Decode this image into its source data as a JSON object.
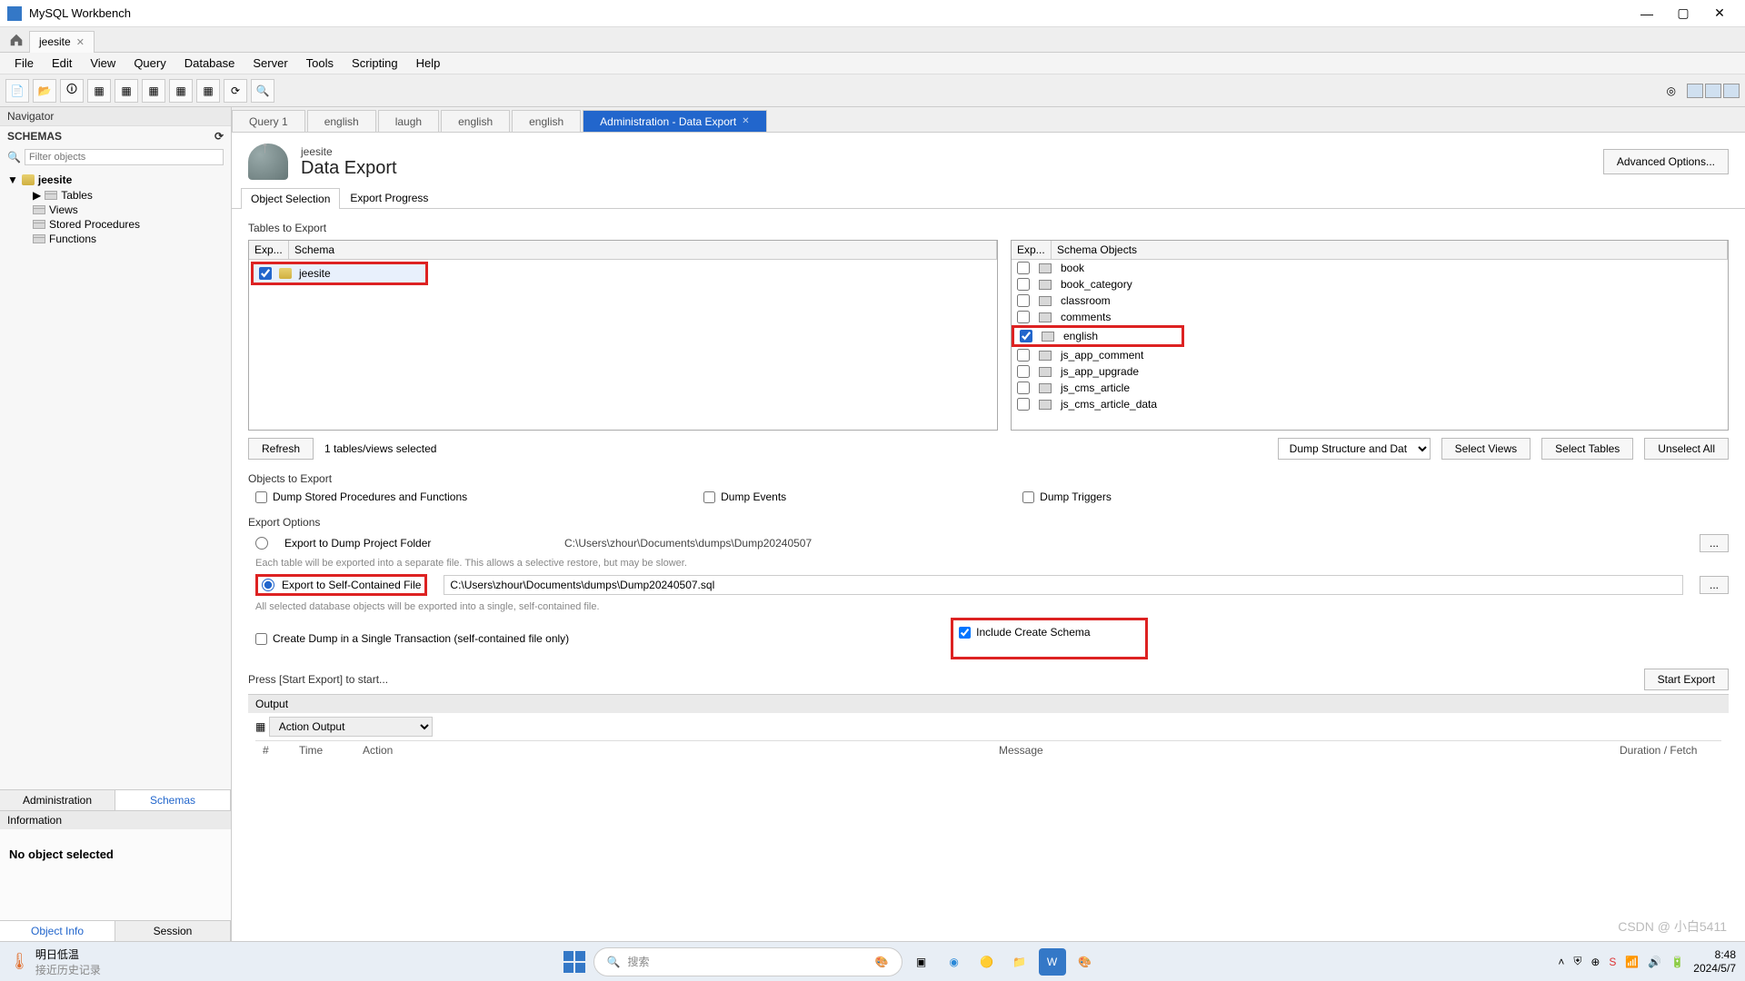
{
  "app": {
    "title": "MySQL Workbench"
  },
  "window_controls": {
    "min": "—",
    "max": "▢",
    "close": "✕"
  },
  "connection_tab": {
    "name": "jeesite"
  },
  "menu": [
    "File",
    "Edit",
    "View",
    "Query",
    "Database",
    "Server",
    "Tools",
    "Scripting",
    "Help"
  ],
  "navigator": {
    "title": "Navigator",
    "schemas_label": "SCHEMAS",
    "filter_placeholder": "Filter objects",
    "db": "jeesite",
    "children": [
      "Tables",
      "Views",
      "Stored Procedures",
      "Functions"
    ],
    "tabs": {
      "admin": "Administration",
      "schemas": "Schemas"
    }
  },
  "information": {
    "title": "Information",
    "body": "No object selected",
    "tabs": {
      "objinfo": "Object Info",
      "session": "Session"
    }
  },
  "query_tabs": [
    "Query 1",
    "english",
    "laugh",
    "english",
    "english"
  ],
  "active_tab": {
    "label": "Administration - Data Export"
  },
  "export": {
    "breadcrumb": "jeesite",
    "title": "Data Export",
    "advanced": "Advanced Options...",
    "subtabs": {
      "obj": "Object Selection",
      "prog": "Export Progress"
    },
    "tables_label": "Tables to Export",
    "schema_headers": {
      "exp": "Exp...",
      "schema": "Schema"
    },
    "schema_row": "jeesite",
    "obj_headers": {
      "exp": "Exp...",
      "objs": "Schema Objects"
    },
    "objects": [
      {
        "name": "book",
        "checked": false
      },
      {
        "name": "book_category",
        "checked": false
      },
      {
        "name": "classroom",
        "checked": false
      },
      {
        "name": "comments",
        "checked": false
      },
      {
        "name": "english",
        "checked": true,
        "highlight": true
      },
      {
        "name": "js_app_comment",
        "checked": false
      },
      {
        "name": "js_app_upgrade",
        "checked": false
      },
      {
        "name": "js_cms_article",
        "checked": false
      },
      {
        "name": "js_cms_article_data",
        "checked": false
      }
    ],
    "refresh": "Refresh",
    "selected_count": "1 tables/views selected",
    "dump_select": "Dump Structure and Dat",
    "select_views": "Select Views",
    "select_tables": "Select Tables",
    "unselect_all": "Unselect All",
    "objects_export_label": "Objects to Export",
    "chk_sp": "Dump Stored Procedures and Functions",
    "chk_events": "Dump Events",
    "chk_triggers": "Dump Triggers",
    "options_label": "Export Options",
    "opt_folder": "Export to Dump Project Folder",
    "opt_folder_path": "C:\\Users\\zhour\\Documents\\dumps\\Dump20240507",
    "opt_folder_hint": "Each table will be exported into a separate file. This allows a selective restore, but may be slower.",
    "opt_file": "Export to Self-Contained File",
    "opt_file_path": "C:\\Users\\zhour\\Documents\\dumps\\Dump20240507.sql",
    "opt_file_hint": "All selected database objects will be exported into a single, self-contained file.",
    "chk_single_tx": "Create Dump in a Single Transaction (self-contained file only)",
    "chk_include_schema": "Include Create Schema",
    "start_hint": "Press [Start Export] to start...",
    "start_btn": "Start Export",
    "browse": "..."
  },
  "output": {
    "title": "Output",
    "dropdown": "Action Output",
    "cols": {
      "num": "#",
      "time": "Time",
      "action": "Action",
      "message": "Message",
      "duration": "Duration / Fetch"
    }
  },
  "taskbar": {
    "weather_line1": "明日低温",
    "weather_line2": "接近历史记录",
    "search_placeholder": "搜索",
    "time": "8:48",
    "date": "2024/5/7"
  },
  "watermark": "CSDN @ 小白5411"
}
